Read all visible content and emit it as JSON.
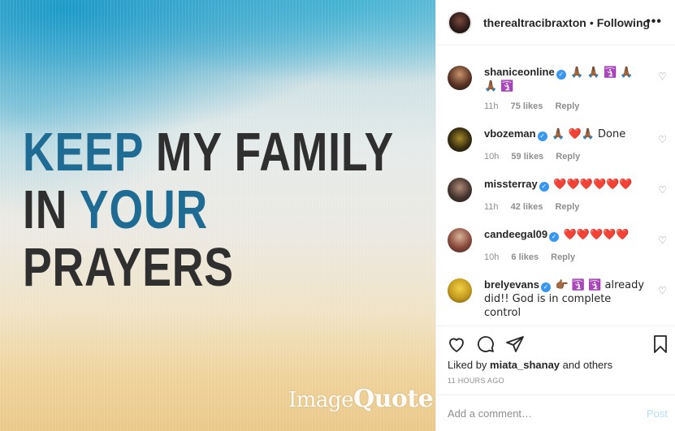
{
  "post": {
    "quote_line1_a": "KEEP",
    "quote_line1_b": "MY FAMILY",
    "quote_line2_a": "IN",
    "quote_line2_b": "YOUR",
    "quote_line3": "PRAYERS",
    "watermark_a": "Image",
    "watermark_b": "Quote",
    "colors": {
      "quote_blue": "#1e6b93",
      "quote_dark": "#2f2f2f"
    }
  },
  "header": {
    "username": "therealtracibraxton",
    "separator": "•",
    "follow_status": "Following",
    "more_icon": "more-horizontal-icon"
  },
  "comments": [
    {
      "user": "shaniceonline",
      "verified": true,
      "text": "🙏🏾 🙏🏾 🛐 🙏🏾 🙏🏾 🛐",
      "time": "11h",
      "likes": "75 likes",
      "reply": "Reply"
    },
    {
      "user": "vbozeman",
      "verified": true,
      "text": "🙏🏾 ❤️🙏🏾 Done",
      "time": "10h",
      "likes": "59 likes",
      "reply": "Reply"
    },
    {
      "user": "missterray",
      "verified": true,
      "text": "❤️❤️❤️❤️❤️❤️",
      "time": "11h",
      "likes": "42 likes",
      "reply": "Reply"
    },
    {
      "user": "candeegal09",
      "verified": true,
      "text": "❤️❤️❤️❤️❤️",
      "time": "10h",
      "likes": "6 likes",
      "reply": "Reply"
    },
    {
      "user": "brelyevans",
      "verified": true,
      "text": "👉🏾 🛐 🛐 already did!! God is in complete control",
      "time": "",
      "likes": "",
      "reply": ""
    }
  ],
  "actions": {
    "liked_by_prefix": "Liked by",
    "liked_by_user": "miata_shanay",
    "liked_by_suffix": "and others",
    "post_time": "11 HOURS AGO"
  },
  "add_comment": {
    "placeholder": "Add a comment…",
    "post_label": "Post"
  },
  "colors": {
    "link_blue": "#3897f0",
    "muted": "#8e8e8e",
    "text": "#262626",
    "post_disabled": "#b2dffc"
  }
}
